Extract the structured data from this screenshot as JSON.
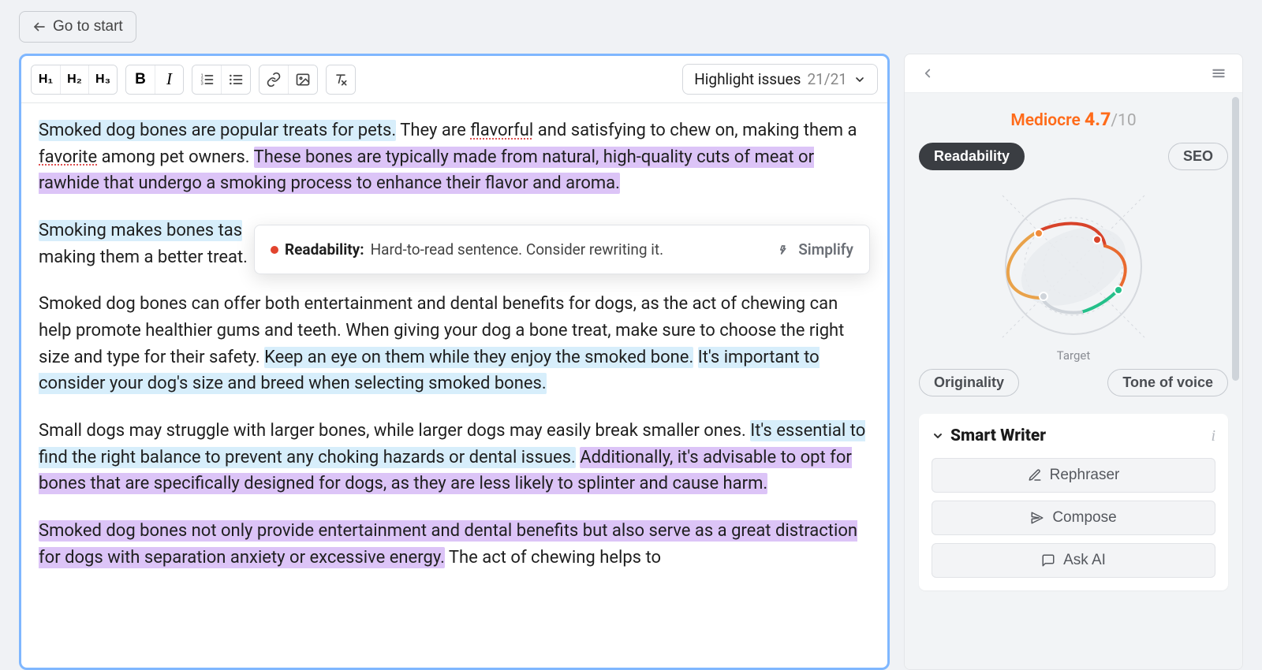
{
  "nav": {
    "go_to_start": "Go to start"
  },
  "toolbar": {
    "h1": "H₁",
    "h2": "H₂",
    "h3": "H₃",
    "bold": "B",
    "italic": "I",
    "highlight_issues_label": "Highlight issues",
    "highlight_issues_count": "21/21"
  },
  "content": {
    "p1_s1": "Smoked dog bones are popular treats for pets.",
    "p1_s2a": " They are ",
    "p1_s2_flavorful": "flavorful",
    "p1_s2b": " and satisfying to chew on, making them a ",
    "p1_s2_favorite": "favorite",
    "p1_s2c": " among pet owners. ",
    "p1_s3": "These bones are typically made from natural, high-quality cuts of meat or rawhide that undergo a smoking process to enhance their flavor and aroma.",
    "p2_s1": "Smoking makes bones tas",
    "p2_s2": "making them a better treat.",
    "p3_s1": "Smoked dog bones can offer both entertainment and dental benefits for dogs, as the act of chewing can help promote healthier gums and teeth. When giving your dog a bone treat, make sure to choose the right size and type for their safety. ",
    "p3_s2": "Keep an eye on them while they enjoy the smoked bone.",
    "p3_s3a": " ",
    "p3_s3": "It's important to consider your dog's size and breed when selecting smoked bones.",
    "p4_s1": "Small dogs may struggle with larger bones, while larger dogs may easily break smaller ones. ",
    "p4_s2": "It's essential to find the right balance to prevent any choking hazards or dental issues.",
    "p4_s3a": " ",
    "p4_s3": "Additionally, it's advisable to opt for bones that are specifically designed for dogs, as they are less likely to splinter and cause harm.",
    "p5_s1": "Smoked dog bones not only provide entertainment and dental benefits but also serve as a great distraction for dogs with separation anxiety or excessive energy.",
    "p5_s2": " The act of chewing helps to"
  },
  "tooltip": {
    "category": "Readability:",
    "message": "Hard-to-read sentence. Consider rewriting it.",
    "action": "Simplify"
  },
  "side": {
    "score_label": "Mediocre",
    "score_value": "4.7",
    "score_max": "/10",
    "pill_readability": "Readability",
    "pill_seo": "SEO",
    "pill_originality": "Originality",
    "pill_tone": "Tone of voice",
    "target": "Target",
    "smart_writer": "Smart Writer",
    "rephraser": "Rephraser",
    "compose": "Compose",
    "ask_ai": "Ask AI"
  },
  "colors": {
    "accent_orange": "#ff6b1a",
    "highlight_blue": "#d7eefb",
    "highlight_purple": "#dcc4f7"
  }
}
